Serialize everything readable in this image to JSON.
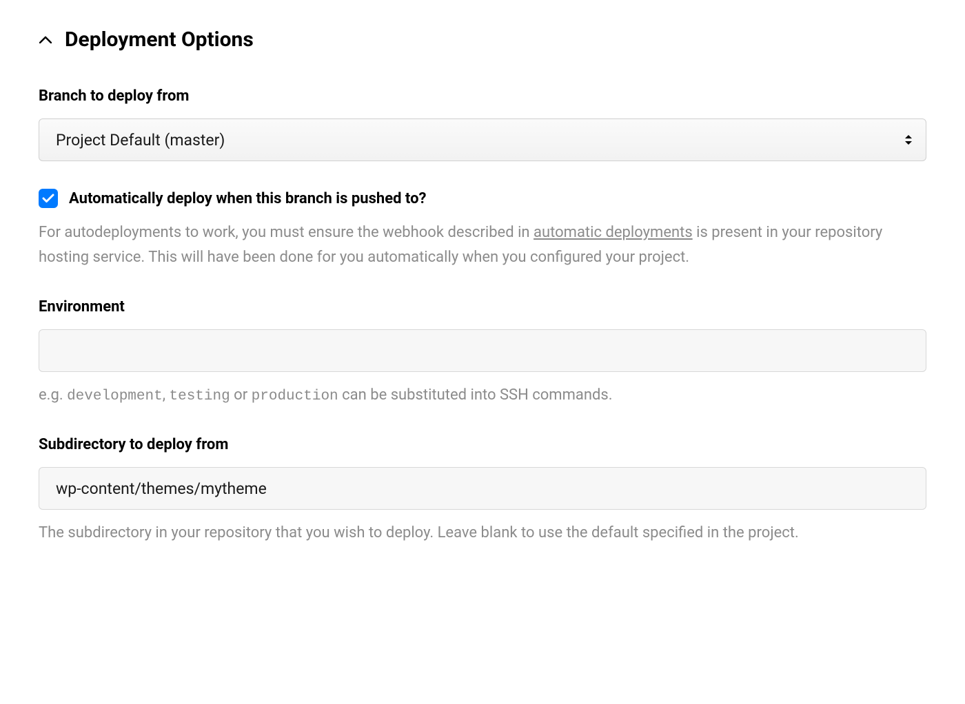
{
  "section": {
    "title": "Deployment Options"
  },
  "branch": {
    "label": "Branch to deploy from",
    "selected": "Project Default (master)"
  },
  "autodeploy": {
    "checked": true,
    "label": "Automatically deploy when this branch is pushed to?",
    "help_prefix": "For autodeployments to work, you must ensure the webhook described in ",
    "help_link": "automatic deployments",
    "help_suffix": " is present in your repository hosting service. This will have been done for you automatically when you configured your project."
  },
  "environment": {
    "label": "Environment",
    "value": "",
    "hint_prefix": "e.g. ",
    "hint_code1": "development",
    "hint_mid1": ", ",
    "hint_code2": "testing",
    "hint_mid2": " or ",
    "hint_code3": "production",
    "hint_suffix": " can be substituted into SSH commands."
  },
  "subdirectory": {
    "label": "Subdirectory to deploy from",
    "value": "wp-content/themes/mytheme",
    "hint": "The subdirectory in your repository that you wish to deploy. Leave blank to use the default specified in the project."
  }
}
